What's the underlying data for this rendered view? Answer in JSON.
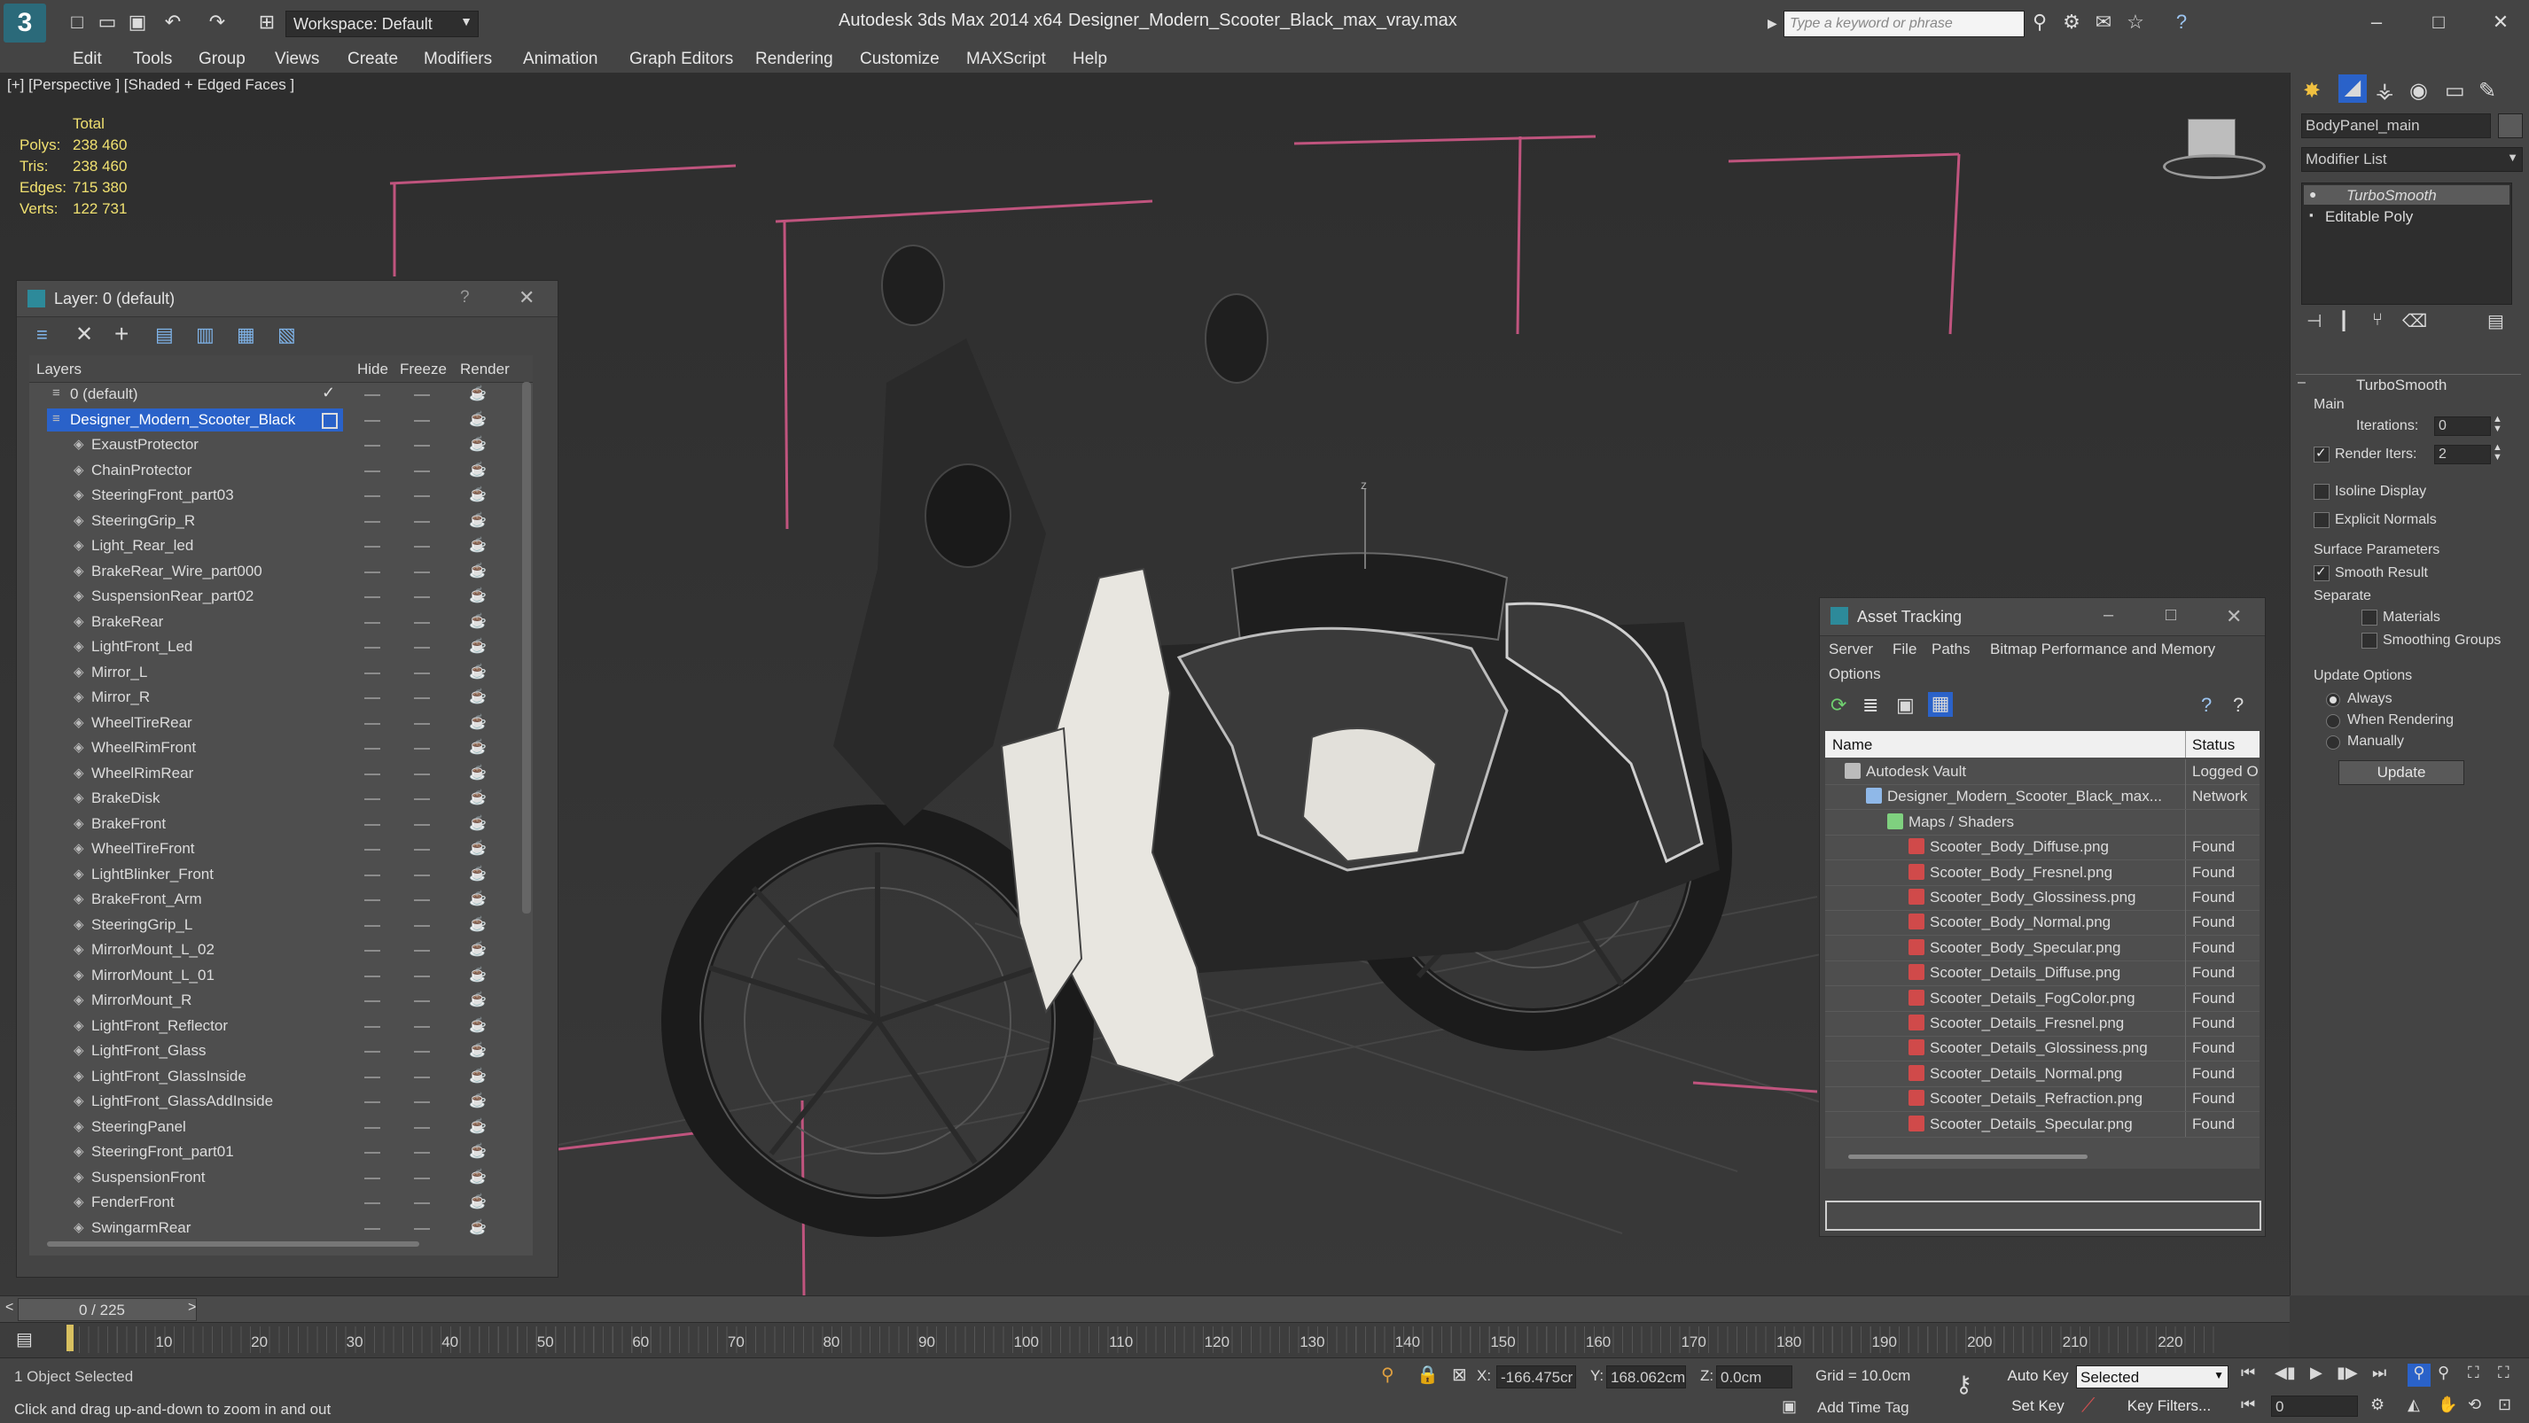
{
  "titlebar": {
    "workspace": "Workspace: Default",
    "app_title": "Autodesk 3ds Max  2014 x64",
    "file_title": "Designer_Modern_Scooter_Black_max_vray.max",
    "search_placeholder": "Type a keyword or phrase"
  },
  "menu": [
    "Edit",
    "Tools",
    "Group",
    "Views",
    "Create",
    "Modifiers",
    "Animation",
    "Graph Editors",
    "Rendering",
    "Customize",
    "MAXScript",
    "Help"
  ],
  "viewport": {
    "label": "[+] [Perspective ] [Shaded + Edged Faces ]",
    "stats": {
      "header": "Total",
      "rows": [
        {
          "label": "Polys:",
          "value": "238 460"
        },
        {
          "label": "Tris:",
          "value": "238 460"
        },
        {
          "label": "Edges:",
          "value": "715 380"
        },
        {
          "label": "Verts:",
          "value": "122 731"
        }
      ]
    },
    "axis_label": "z"
  },
  "layer_panel": {
    "title": "Layer: 0 (default)",
    "help": "?",
    "columns": {
      "layers": "Layers",
      "hide": "Hide",
      "freeze": "Freeze",
      "render": "Render"
    },
    "rows": [
      "0 (default)",
      "Designer_Modern_Scooter_Black",
      "ExaustProtector",
      "ChainProtector",
      "SteeringFront_part03",
      "SteeringGrip_R",
      "Light_Rear_led",
      "BrakeRear_Wire_part000",
      "SuspensionRear_part02",
      "BrakeRear",
      "LightFront_Led",
      "Mirror_L",
      "Mirror_R",
      "WheelTireRear",
      "WheelRimFront",
      "WheelRimRear",
      "BrakeDisk",
      "BrakeFront",
      "WheelTireFront",
      "LightBlinker_Front",
      "BrakeFront_Arm",
      "SteeringGrip_L",
      "MirrorMount_L_02",
      "MirrorMount_L_01",
      "MirrorMount_R",
      "LightFront_Reflector",
      "LightFront_Glass",
      "LightFront_GlassInside",
      "LightFront_GlassAddInside",
      "SteeringPanel",
      "SteeringFront_part01",
      "SuspensionFront",
      "FenderFront",
      "SwingarmRear"
    ]
  },
  "asset_tracking": {
    "title": "Asset Tracking",
    "menu": [
      "Server",
      "File",
      "Paths",
      "Bitmap Performance and Memory",
      "Options"
    ],
    "columns": {
      "name": "Name",
      "status": "Status"
    },
    "rows": [
      {
        "name": "Autodesk Vault",
        "status": "Logged O",
        "indent": 0
      },
      {
        "name": "Designer_Modern_Scooter_Black_max...",
        "status": "Network",
        "indent": 1
      },
      {
        "name": "Maps / Shaders",
        "status": "",
        "indent": 2
      },
      {
        "name": "Scooter_Body_Diffuse.png",
        "status": "Found",
        "indent": 3
      },
      {
        "name": "Scooter_Body_Fresnel.png",
        "status": "Found",
        "indent": 3
      },
      {
        "name": "Scooter_Body_Glossiness.png",
        "status": "Found",
        "indent": 3
      },
      {
        "name": "Scooter_Body_Normal.png",
        "status": "Found",
        "indent": 3
      },
      {
        "name": "Scooter_Body_Specular.png",
        "status": "Found",
        "indent": 3
      },
      {
        "name": "Scooter_Details_Diffuse.png",
        "status": "Found",
        "indent": 3
      },
      {
        "name": "Scooter_Details_FogColor.png",
        "status": "Found",
        "indent": 3
      },
      {
        "name": "Scooter_Details_Fresnel.png",
        "status": "Found",
        "indent": 3
      },
      {
        "name": "Scooter_Details_Glossiness.png",
        "status": "Found",
        "indent": 3
      },
      {
        "name": "Scooter_Details_Normal.png",
        "status": "Found",
        "indent": 3
      },
      {
        "name": "Scooter_Details_Refraction.png",
        "status": "Found",
        "indent": 3
      },
      {
        "name": "Scooter_Details_Specular.png",
        "status": "Found",
        "indent": 3
      }
    ]
  },
  "command_panel": {
    "object_name": "BodyPanel_main",
    "modifier_list": "Modifier List",
    "stack": [
      "TurboSmooth",
      "Editable Poly"
    ],
    "rollout_title": "TurboSmooth",
    "main_label": "Main",
    "iterations_label": "Iterations:",
    "iterations_value": "0",
    "render_iters_label": "Render Iters:",
    "render_iters_value": "2",
    "isoline_display": "Isoline Display",
    "explicit_normals": "Explicit Normals",
    "surface_params": "Surface Parameters",
    "smooth_result": "Smooth Result",
    "separate": "Separate",
    "materials": "Materials",
    "smoothing_groups": "Smoothing Groups",
    "update_options": "Update Options",
    "always": "Always",
    "when_rendering": "When Rendering",
    "manually": "Manually",
    "update_button": "Update"
  },
  "timeline": {
    "frame_counter": "0 / 225",
    "ticks": [
      "10",
      "20",
      "30",
      "40",
      "50",
      "60",
      "70",
      "80",
      "90",
      "100",
      "110",
      "120",
      "130",
      "140",
      "150",
      "160",
      "170",
      "180",
      "190",
      "200",
      "210",
      "220"
    ]
  },
  "status": {
    "selected": "1 Object Selected",
    "prompt": "Click and drag up-and-down to zoom in and out",
    "x_label": "X:",
    "x_value": "-166.475cr",
    "y_label": "Y:",
    "y_value": "168.062cm",
    "z_label": "Z:",
    "z_value": "0.0cm",
    "grid": "Grid = 10.0cm",
    "add_time_tag": "Add Time Tag",
    "auto_key": "Auto Key",
    "selected_dropdown": "Selected",
    "set_key": "Set Key",
    "key_filters": "Key Filters...",
    "frame_value": "0"
  },
  "colors": {
    "accent_blue": "#2a62c9",
    "panel": "#444444",
    "viewport_border": "#c8a86a"
  }
}
